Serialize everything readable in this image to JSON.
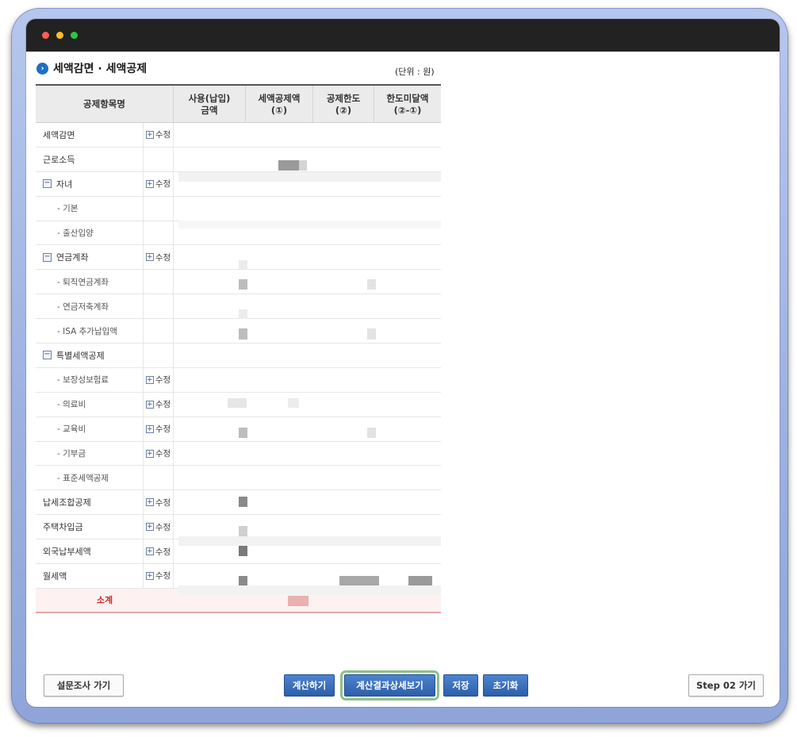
{
  "section": {
    "title": "세액감면 · 세액공제",
    "unit_label": "(단위 : 원)"
  },
  "table": {
    "headers": [
      "공제항목명",
      "사용(납입)\n금액",
      "세액공제액\n(①)",
      "공제한도\n(②)",
      "한도미달액\n(②-①)"
    ],
    "rows": [
      {
        "label": "세액감면",
        "level": 0,
        "expand": false,
        "edit": "수정"
      },
      {
        "label": "근로소득",
        "level": 0,
        "expand": false,
        "edit": ""
      },
      {
        "label": "자녀",
        "level": 0,
        "expand": true,
        "edit": "수정"
      },
      {
        "label": "- 기본",
        "level": 1,
        "expand": false,
        "edit": ""
      },
      {
        "label": "- 출산입양",
        "level": 1,
        "expand": false,
        "edit": ""
      },
      {
        "label": "연금계좌",
        "level": 0,
        "expand": true,
        "edit": "수정"
      },
      {
        "label": "- 퇴직연금계좌",
        "level": 1,
        "expand": false,
        "edit": ""
      },
      {
        "label": "- 연금저축계좌",
        "level": 1,
        "expand": false,
        "edit": ""
      },
      {
        "label": "- ISA 추가납입액",
        "level": 1,
        "expand": false,
        "edit": ""
      },
      {
        "label": "특별세액공제",
        "level": 0,
        "expand": true,
        "edit": ""
      },
      {
        "label": "- 보장성보험료",
        "level": 1,
        "expand": false,
        "edit": "수정"
      },
      {
        "label": "- 의료비",
        "level": 1,
        "expand": false,
        "edit": "수정"
      },
      {
        "label": "- 교육비",
        "level": 1,
        "expand": false,
        "edit": "수정"
      },
      {
        "label": "- 기부금",
        "level": 1,
        "expand": false,
        "edit": "수정"
      },
      {
        "label": "- 표준세액공제",
        "level": 1,
        "expand": false,
        "edit": ""
      },
      {
        "label": "납세조합공제",
        "level": 0,
        "expand": false,
        "edit": "수정"
      },
      {
        "label": "주택차입금",
        "level": 0,
        "expand": false,
        "edit": "수정"
      },
      {
        "label": "외국납부세액",
        "level": 0,
        "expand": false,
        "edit": "수정"
      },
      {
        "label": "월세액",
        "level": 0,
        "expand": false,
        "edit": "수정"
      }
    ],
    "subtotal_label": "소계"
  },
  "buttons": {
    "survey": "설문조사 가기",
    "calculate": "계산하기",
    "result_detail": "계산결과상세보기",
    "save": "저장",
    "reset": "초기화",
    "next_step": "Step 02 가기"
  },
  "icons": {
    "heading": "circle-arrow-right-icon",
    "expand": "minus-box-icon",
    "edit": "plus-box-icon"
  },
  "colors": {
    "primary_button": "#2d5fa8",
    "heading_icon": "#1d6fc4",
    "subtotal_text": "#cc2a2a",
    "focus_outline": "#8ec08a"
  }
}
